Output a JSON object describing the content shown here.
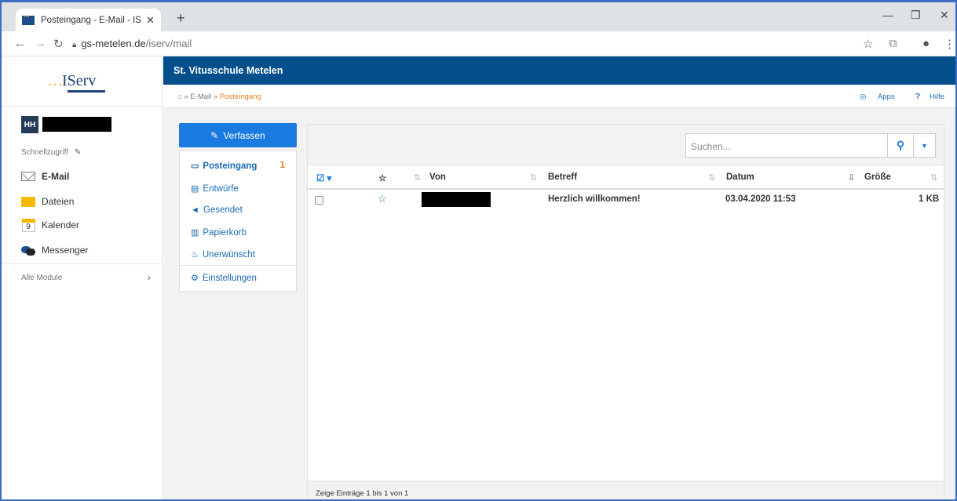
{
  "browser": {
    "tab_title": "Posteingang - E-Mail - IServ - gs",
    "tab_close": "✕",
    "new_tab": "+",
    "url_host": "gs-metelen.de",
    "url_path": "/iserv/mail",
    "window_min": "—",
    "window_max": "❐",
    "window_close": "✕"
  },
  "sidebar": {
    "logo_text": "IServ",
    "user_initials": "HH",
    "quick_access": "Schnellzugriff",
    "items": [
      {
        "label": "E-Mail",
        "icon": "mail-icon",
        "active": true
      },
      {
        "label": "Dateien",
        "icon": "folder-icon"
      },
      {
        "label": "Kalender",
        "icon": "calendar-icon",
        "day": "9"
      },
      {
        "label": "Messenger",
        "icon": "messenger-icon"
      }
    ],
    "all_modules": "Alle Module"
  },
  "header": {
    "school": "St. Vitusschule Metelen"
  },
  "breadcrumb": {
    "items": [
      "E-Mail",
      "Posteingang"
    ],
    "separator": "»",
    "apps": "Apps",
    "help": "Hilfe"
  },
  "mail": {
    "compose_label": "Verfassen",
    "folders": [
      {
        "label": "Posteingang",
        "icon": "inbox-icon",
        "count": "1",
        "active": true
      },
      {
        "label": "Entwürfe",
        "icon": "drafts-icon"
      },
      {
        "label": "Gesendet",
        "icon": "sent-icon"
      },
      {
        "label": "Papierkorb",
        "icon": "trash-icon"
      },
      {
        "label": "Unerwünscht",
        "icon": "spam-icon"
      }
    ],
    "settings_label": "Einstellungen",
    "search_placeholder": "Suchen...",
    "columns": {
      "from": "Von",
      "subject": "Betreff",
      "date": "Datum",
      "size": "Größe"
    },
    "rows": [
      {
        "subject": "Herzlich willkommen!",
        "date": "03.04.2020 11:53",
        "size": "1 KB"
      }
    ],
    "footer": "Zeige Einträge 1 bis 1 von 1"
  },
  "colors": {
    "header_bg": "#024f8c",
    "accent": "#1a7ae0",
    "breadcrumb_current": "#e47f23",
    "logo_dots": "#f3b325"
  }
}
